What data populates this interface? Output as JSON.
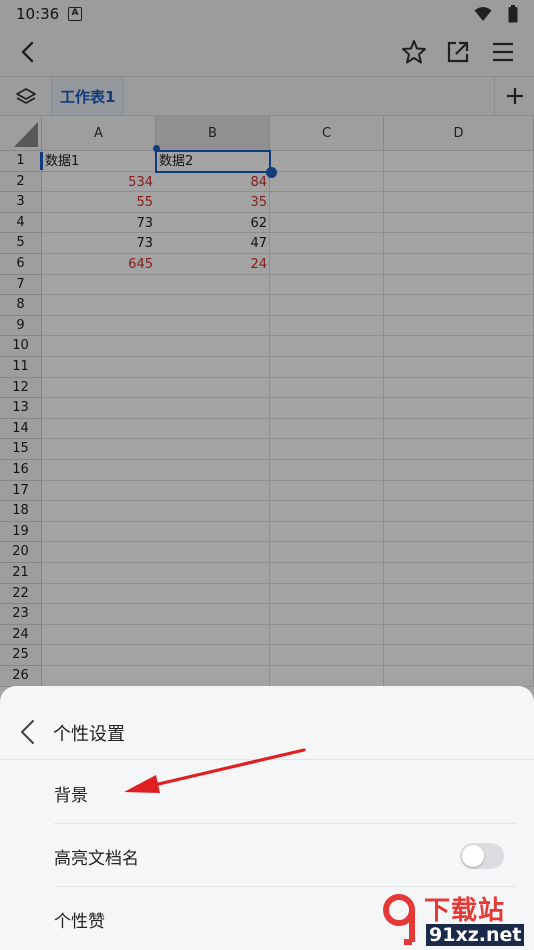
{
  "status_bar": {
    "time": "10:36",
    "notification": "A"
  },
  "toolbar": {
    "back": "back",
    "star": "star",
    "share": "open-external",
    "menu": "menu"
  },
  "sheet_tabs": {
    "active_tab": "工作表1",
    "add_symbol": "+"
  },
  "grid": {
    "columns": [
      "A",
      "B",
      "C",
      "D"
    ],
    "selected_column": "B",
    "rows": [
      "1",
      "2",
      "3",
      "4",
      "5",
      "6",
      "7",
      "8",
      "9",
      "10",
      "11",
      "12",
      "13",
      "14",
      "15",
      "16",
      "17",
      "18",
      "19",
      "20",
      "21",
      "22",
      "23",
      "24",
      "25",
      "26"
    ],
    "header_row": {
      "a": "数据1",
      "b": "数据2"
    },
    "data": [
      {
        "a": "534",
        "a_color": "red",
        "b": "84",
        "b_color": "red"
      },
      {
        "a": "55",
        "a_color": "red",
        "b": "35",
        "b_color": "red"
      },
      {
        "a": "73",
        "a_color": "black",
        "b": "62",
        "b_color": "black"
      },
      {
        "a": "73",
        "a_color": "black",
        "b": "47",
        "b_color": "black"
      },
      {
        "a": "645",
        "a_color": "red",
        "b": "24",
        "b_color": "red"
      }
    ],
    "accent_color": "#1a5ec2",
    "red_color": "#d32f2f"
  },
  "bottom_sheet": {
    "title": "个性设置",
    "items": [
      {
        "label": "背景"
      },
      {
        "label": "高亮文档名",
        "toggle": false
      },
      {
        "label": "个性赞"
      }
    ]
  },
  "watermark": {
    "top": "下载站",
    "bottom": "91xz.net"
  }
}
